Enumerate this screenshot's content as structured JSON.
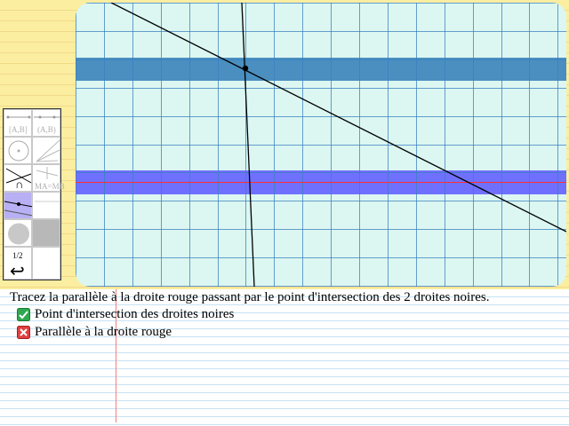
{
  "instruction": "Tracez la parallèle à la droite rouge passant par le point d'intersection des 2 droites noires.",
  "checklist": [
    {
      "label": "Point d'intersection des droites noires",
      "status": "done",
      "icon": "check-icon"
    },
    {
      "label": "Parallèle à la droite rouge",
      "status": "failed",
      "icon": "cross-icon"
    }
  ],
  "toolbar": {
    "tools": [
      {
        "name": "segment-tool",
        "label": "[A,B]"
      },
      {
        "name": "line-tool",
        "label": "(A,B)"
      },
      {
        "name": "circle-tool",
        "label": ""
      },
      {
        "name": "ray-tool",
        "label": ""
      },
      {
        "name": "intersection-tool",
        "label": "∩"
      },
      {
        "name": "midpoint-tool",
        "label": "MA=MB"
      },
      {
        "name": "parallel-tool",
        "label": ""
      },
      {
        "name": "perpendicular-tool",
        "label": ""
      },
      {
        "name": "point-tool",
        "label": ""
      },
      {
        "name": "fill-tool",
        "label": ""
      },
      {
        "name": "page-indicator",
        "label": "1/2"
      },
      {
        "name": "undo-tool",
        "label": "↩"
      }
    ]
  },
  "colors": {
    "board_background": "#dcf7f1",
    "grid": "#3a7fc0",
    "band_top": "#4a8fc0",
    "band_red_line": "#7a7aff",
    "red_line": "#ff3030",
    "black_lines": "#000000",
    "check_green": "#2fa84f",
    "cross_red": "#e04040"
  }
}
